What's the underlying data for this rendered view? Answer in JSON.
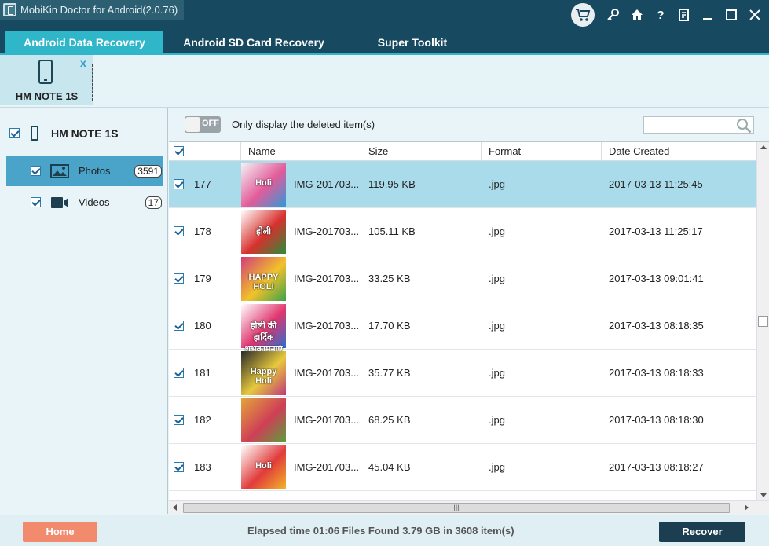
{
  "app": {
    "title": "MobiKin Doctor for Android(2.0.76)"
  },
  "window_icons": [
    "cart-icon",
    "key-icon",
    "home-icon",
    "help-icon",
    "register-icon",
    "minimize-icon",
    "maximize-icon",
    "close-icon"
  ],
  "tabs": [
    {
      "label": "Android Data Recovery",
      "active": true
    },
    {
      "label": "Android SD Card Recovery",
      "active": false
    },
    {
      "label": "Super Toolkit",
      "active": false
    }
  ],
  "device_strip": {
    "device_name": "HM NOTE 1S",
    "close_label": "x"
  },
  "sidebar": {
    "device_name": "HM NOTE 1S",
    "items": [
      {
        "label": "Photos",
        "count": "3591",
        "icon": "photo-icon"
      },
      {
        "label": "Videos",
        "count": "17",
        "icon": "video-icon"
      }
    ]
  },
  "toolbar": {
    "toggle_text": "OFF",
    "filter_label": "Only display the deleted item(s)",
    "search_placeholder": ""
  },
  "table": {
    "columns": [
      "Name",
      "Size",
      "Format",
      "Date Created"
    ],
    "rows": [
      {
        "num": "177",
        "name": "IMG-201703...",
        "size": "119.95 KB",
        "format": ".jpg",
        "date": "2017-03-13 11:25:45",
        "selected": true,
        "thumb_colors": [
          "#f4f4f4",
          "#e35b9a",
          "#2e9ad8"
        ],
        "thumb_text": "Holi"
      },
      {
        "num": "178",
        "name": "IMG-201703...",
        "size": "105.11 KB",
        "format": ".jpg",
        "date": "2017-03-13 11:25:17",
        "selected": false,
        "thumb_colors": [
          "#ffffff",
          "#d8302d",
          "#2a8d3a"
        ],
        "thumb_text": "होली"
      },
      {
        "num": "179",
        "name": "IMG-201703...",
        "size": "33.25 KB",
        "format": ".jpg",
        "date": "2017-03-13 09:01:41",
        "selected": false,
        "thumb_colors": [
          "#d23c7a",
          "#f2c22a",
          "#3da04a"
        ],
        "thumb_text": "HAPPY HOLI"
      },
      {
        "num": "180",
        "name": "IMG-201703...",
        "size": "17.70 KB",
        "format": ".jpg",
        "date": "2017-03-13 08:18:35",
        "selected": false,
        "thumb_colors": [
          "#ffffff",
          "#e0356f",
          "#2a6fd0"
        ],
        "thumb_text": "होली की हार्दिक शुभकामनाएं"
      },
      {
        "num": "181",
        "name": "IMG-201703...",
        "size": "35.77 KB",
        "format": ".jpg",
        "date": "2017-03-13 08:18:33",
        "selected": false,
        "thumb_colors": [
          "#2a2a2a",
          "#e7c93c",
          "#c0367a"
        ],
        "thumb_text": "Happy Holi"
      },
      {
        "num": "182",
        "name": "IMG-201703...",
        "size": "68.25 KB",
        "format": ".jpg",
        "date": "2017-03-13 08:18:30",
        "selected": false,
        "thumb_colors": [
          "#e2a43a",
          "#cf3f57",
          "#5b9f3a"
        ],
        "thumb_text": ""
      },
      {
        "num": "183",
        "name": "IMG-201703...",
        "size": "45.04 KB",
        "format": ".jpg",
        "date": "2017-03-13 08:18:27",
        "selected": false,
        "thumb_colors": [
          "#ffffff",
          "#e13b3b",
          "#f3b62a"
        ],
        "thumb_text": "Holi"
      }
    ]
  },
  "footer": {
    "home_label": "Home",
    "status": "Elapsed time 01:06   Files Found 3.79 GB in 3608 item(s)",
    "recover_label": "Recover"
  },
  "colors": {
    "title_bar": "#174a60",
    "active_tab": "#2fb6c9",
    "selected_row": "#a9dbeb",
    "sidebar_active": "#4aa3c8",
    "home_button": "#f28a6e",
    "recover_button": "#1b3e50"
  }
}
